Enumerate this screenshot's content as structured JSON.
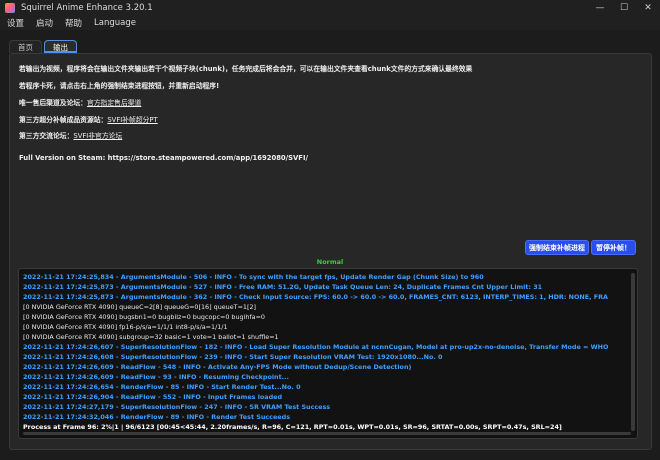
{
  "window": {
    "title": "Squirrel Anime Enhance 3.20.1",
    "minimize": "—",
    "maximize": "☐",
    "close": "✕"
  },
  "menu": [
    "设置",
    "启动",
    "帮助",
    "Language"
  ],
  "tabs": [
    "首页",
    "输出"
  ],
  "info": {
    "line1": "若输出为视频，程序将会在输出文件夹输出若干个视频子块(chunk)，任务完成后将会合并，可以在输出文件夹查看chunk文件的方式来确认最终效果",
    "line2": "若程序卡死，请点击右上角的强制结束进程按钮，并重新启动程序!",
    "line3_label": "唯一售后渠道及论坛：",
    "line3_link": "官方指定售后渠道",
    "line4_label": "第三方超分补帧成品资源站：",
    "line4_link": "SVFI补帧超分PT",
    "line5_label": "第三方交流论坛：",
    "line5_link": "SVFI非官方论坛",
    "line6": "Full Version on Steam: https://store.steampowered.com/app/1692080/SVFI/"
  },
  "status": "Normal",
  "buttons": {
    "force_kill": "强制结束补帧进程",
    "pause": "暂停补帧！"
  },
  "log": [
    {
      "style": "blue",
      "text": "2022-11-21 17:24:25,834 - ArgumentsModule - 506 - INFO - To sync with the target fps, Update Render Gap (Chunk Size) to 960"
    },
    {
      "style": "blue",
      "text": "2022-11-21 17:24:25,873 - ArgumentsModule - 527 - INFO - Free RAM: 51.2G, Update Task Queue Len: 24, Duplicate Frames Cnt Upper Limit: 31"
    },
    {
      "style": "blue",
      "text": "2022-11-21 17:24:25,873 - ArgumentsModule - 362 - INFO - Check Input Source: FPS: 60.0 -> 60.0 -> 60.0, FRAMES_CNT: 6123, INTERP_TIMES: 1, HDR: NONE, FRA"
    },
    {
      "style": "white",
      "text": "[0 NVIDIA GeForce RTX 4090]  queueC=2[8]  queueG=0[16]  queueT=1[2]"
    },
    {
      "style": "white",
      "text": "[0 NVIDIA GeForce RTX 4090]  bugsbn1=0  bugbilz=0  bugcopc=0  bugihfa=0"
    },
    {
      "style": "white",
      "text": "[0 NVIDIA GeForce RTX 4090]  fp16-p/s/a=1/1/1  int8-p/s/a=1/1/1"
    },
    {
      "style": "white",
      "text": "[0 NVIDIA GeForce RTX 4090]  subgroup=32  basic=1  vote=1  ballot=1  shuffle=1"
    },
    {
      "style": "blue",
      "text": "2022-11-21 17:24:26,607 - SuperResolutionFlow - 182 - INFO - Load Super Resolution Module at ncnnCugan, Model at pro-up2x-no-denoise, Transfer Mode = WHO"
    },
    {
      "style": "blue",
      "text": "2022-11-21 17:24:26,608 - SuperResolutionFlow - 239 - INFO - Start Super Resolution VRAM Test: 1920x1080...No. 0"
    },
    {
      "style": "blue",
      "text": "2022-11-21 17:24:26,609 - ReadFlow - 548 - INFO - Activate Any-FPS Mode without Dedup/Scene Detection)"
    },
    {
      "style": "blue",
      "text": "2022-11-21 17:24:26,609 - ReadFlow - 93 - INFO - Resuming Checkpoint..."
    },
    {
      "style": "blue",
      "text": "2022-11-21 17:24:26,654 - RenderFlow - 85 - INFO - Start Render Test...No. 0"
    },
    {
      "style": "blue",
      "text": "2022-11-21 17:24:26,904 - ReadFlow - 552 - INFO - Input Frames loaded"
    },
    {
      "style": "blue",
      "text": "2022-11-21 17:24:27,179 - SuperResolutionFlow - 247 - INFO - SR VRAM Test Success"
    },
    {
      "style": "blue",
      "text": "2022-11-21 17:24:32,046 - RenderFlow - 89 - INFO - Render Test Succeeds"
    },
    {
      "style": "bright",
      "text": "Process at Frame 96:  2%|1  | 96/6123 [00:45<45:44, 2.20frames/s, R=96, C=121, RPT=0.01s, WPT=0.01s, SR=96, SRTAT=0.00s, SRPT=0.47s, SRL=24]"
    }
  ]
}
